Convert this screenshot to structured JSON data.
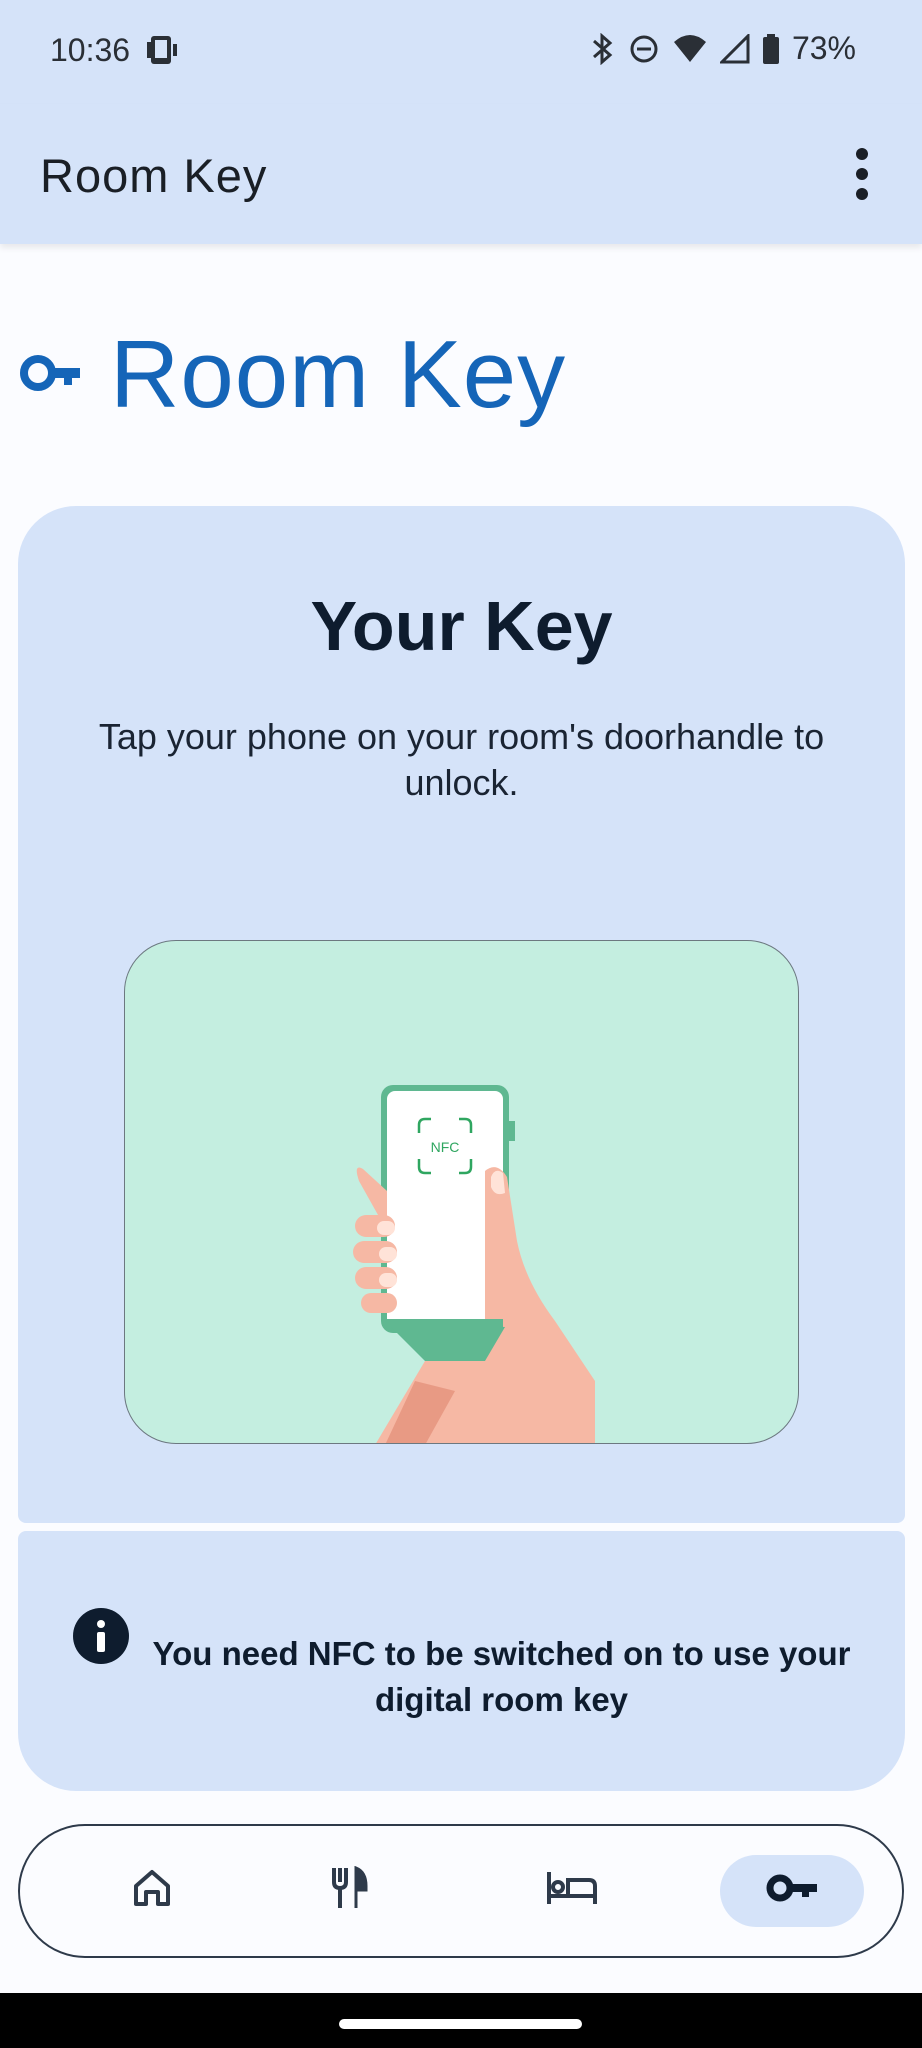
{
  "status_bar": {
    "time": "10:36",
    "battery": "73%",
    "icons": [
      "nfc-phone-icon",
      "bluetooth-icon",
      "do-not-disturb-icon",
      "wifi-icon",
      "cell-signal-icon",
      "battery-icon"
    ]
  },
  "app_bar": {
    "title": "Room Key",
    "menu_icon": "more-vert-icon"
  },
  "page": {
    "heading": "Room Key",
    "heading_icon": "key-icon"
  },
  "key_card": {
    "title": "Your Key",
    "description": "Tap your phone on your room's doorhandle to unlock.",
    "illustration_label": "NFC"
  },
  "info_card": {
    "icon": "info-icon",
    "message": "You need NFC to be switched on to use your digital room key"
  },
  "bottom_nav": {
    "items": [
      {
        "icon": "home-icon",
        "active": false
      },
      {
        "icon": "restaurant-icon",
        "active": false
      },
      {
        "icon": "bed-icon",
        "active": false
      },
      {
        "icon": "key-icon",
        "active": true
      }
    ]
  },
  "colors": {
    "surface": "#d5e3f9",
    "accent": "#1565b8",
    "background": "#fbfcff",
    "illustration_bg": "#c4eee0",
    "nfc_green": "#2fa660"
  }
}
